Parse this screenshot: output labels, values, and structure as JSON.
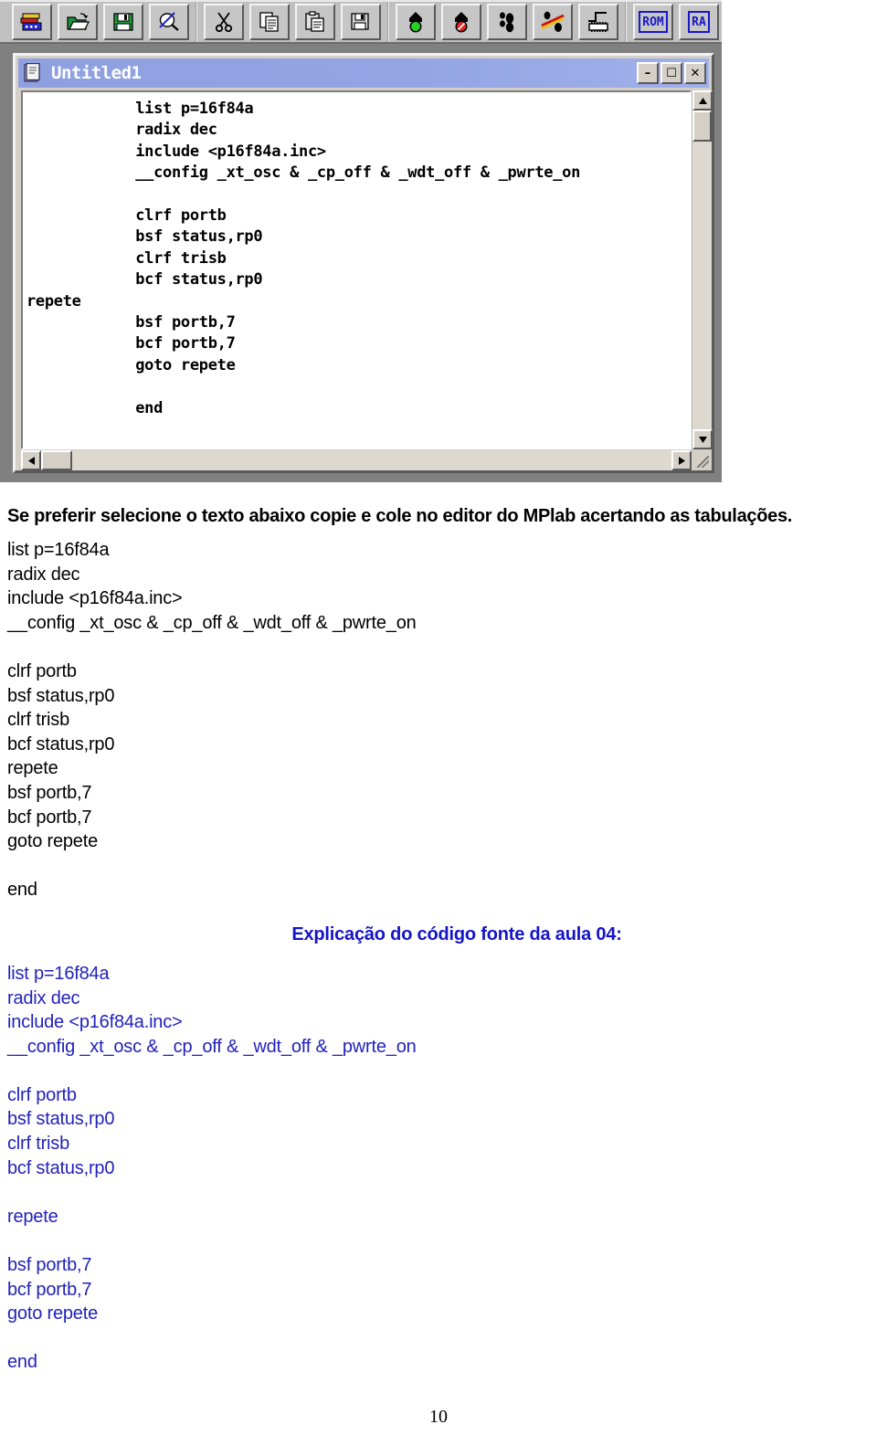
{
  "toolbar": {
    "groups": [
      {
        "buttons": [
          {
            "name": "new-project-icon",
            "label": "New Project"
          },
          {
            "name": "open-folder-icon",
            "label": "Open"
          },
          {
            "name": "save-floppy-icon",
            "label": "Save"
          },
          {
            "name": "find-icon",
            "label": "Find"
          }
        ]
      },
      {
        "buttons": [
          {
            "name": "cut-scissors-icon",
            "label": "Cut"
          },
          {
            "name": "copy-icon",
            "label": "Copy"
          },
          {
            "name": "paste-clipboard-icon",
            "label": "Paste"
          },
          {
            "name": "save-all-icon",
            "label": "Save All"
          }
        ]
      },
      {
        "buttons": [
          {
            "name": "run-green-light-icon",
            "label": "Run"
          },
          {
            "name": "halt-red-light-icon",
            "label": "Halt"
          },
          {
            "name": "step-footprints-icon",
            "label": "Step"
          },
          {
            "name": "step-over-icon",
            "label": "Step Over"
          },
          {
            "name": "reset-pulse-icon",
            "label": "Reset"
          }
        ]
      },
      {
        "buttons": [
          {
            "name": "rom-memory-icon",
            "label": "ROM"
          },
          {
            "name": "ram-memory-icon",
            "label": "RAM"
          }
        ]
      }
    ],
    "rom_label": "ROM",
    "ram_label": "RA"
  },
  "window": {
    "title": "Untitled1",
    "icon_name": "document-icon",
    "minimize_label": "–",
    "maximize_label": "☐",
    "close_label": "✕",
    "editor_code": "            list p=16f84a\n            radix dec\n            include <p16f84a.inc>\n            __config _xt_osc & _cp_off & _wdt_off & _pwrte_on\n\n            clrf portb\n            bsf status,rp0\n            clrf trisb\n            bcf status,rp0\nrepete\n            bsf portb,7\n            bcf portb,7\n            goto repete\n\n            end",
    "scroll": {
      "up_arrow": "▲",
      "down_arrow": "▼",
      "left_arrow": "◀",
      "right_arrow": "▶"
    }
  },
  "document": {
    "intro_text": "Se preferir selecione o texto abaixo copie e cole no editor do MPlab acertando as tabulações.",
    "plain_code": "list p=16f84a\nradix dec\ninclude <p16f84a.inc>\n__config _xt_osc & _cp_off & _wdt_off & _pwrte_on\n\nclrf portb\nbsf status,rp0\nclrf trisb\nbcf status,rp0\nrepete\nbsf portb,7\nbcf portb,7\ngoto repete\n\nend",
    "heading": "Explicação do código fonte da aula 04:",
    "blue_code": "list p=16f84a\nradix dec\ninclude <p16f84a.inc>\n__config _xt_osc & _cp_off & _wdt_off & _pwrte_on\n\nclrf portb\nbsf status,rp0\nclrf trisb\nbcf status,rp0\n\nrepete\n\nbsf portb,7\nbcf portb,7\ngoto repete\n\nend",
    "page_number": "10"
  },
  "colors": {
    "heading_blue": "#1414c8",
    "code_blue": "#2222bb",
    "titlebar_blue": "#8ea0e0",
    "toolbar_gray": "#c0c0c0"
  }
}
